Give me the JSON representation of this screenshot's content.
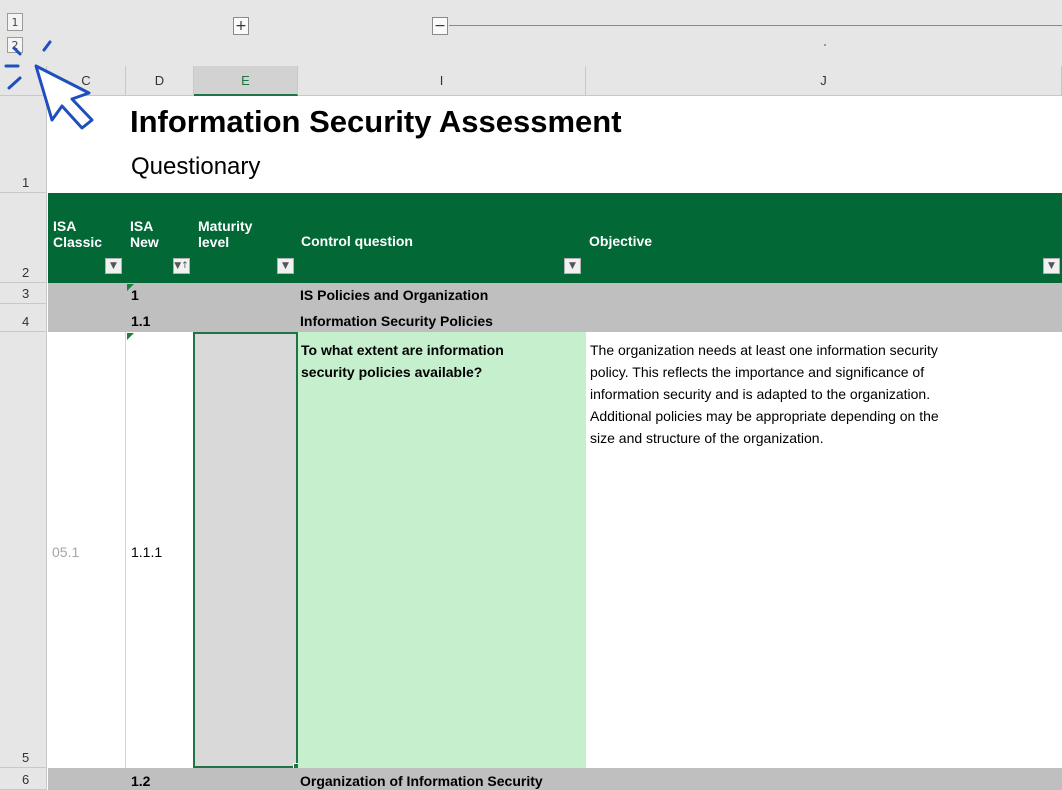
{
  "outline": {
    "level_buttons": [
      "1",
      "2"
    ],
    "expand_symbol": "+",
    "collapse_symbol": "−"
  },
  "columns": [
    "C",
    "D",
    "E",
    "I",
    "J"
  ],
  "title": "Information Security Assessment",
  "subtitle": "Questionary",
  "headers": {
    "isa_classic": [
      "ISA",
      "Classic"
    ],
    "isa_new": [
      "ISA",
      "New"
    ],
    "maturity": [
      "Maturity",
      "level"
    ],
    "control_question": "Control question",
    "objective": "Objective"
  },
  "row_numbers": [
    "1",
    "2",
    "3",
    "4",
    "5",
    "6"
  ],
  "rows": {
    "r3": {
      "isa_new": "1",
      "question": "IS Policies and Organization"
    },
    "r4": {
      "isa_new": "1.1",
      "question": "Information Security Policies"
    },
    "r5": {
      "isa_classic": "05.1",
      "isa_new": "1.1.1",
      "question": [
        "To what extent are information",
        "security policies available?"
      ],
      "objective": [
        "The organization needs at least one information security",
        "policy. This reflects the importance and significance of",
        "information security and is adapted to the organization.",
        "Additional policies may be appropriate depending on the",
        "size and structure of the organization."
      ]
    },
    "r6": {
      "isa_new": "1.2",
      "question": "Organization of Information Security"
    }
  },
  "colors": {
    "header_green": "#016836",
    "section_gray": "#bfbfbf",
    "question_fill": "#c6efce",
    "maturity_fill": "#d9d9d9",
    "selection_border": "#217346",
    "cursor_blue": "#1f4fbf"
  },
  "icons": {
    "filter": "filter-dropdown-icon",
    "cursor": "pointer-cursor-icon"
  }
}
